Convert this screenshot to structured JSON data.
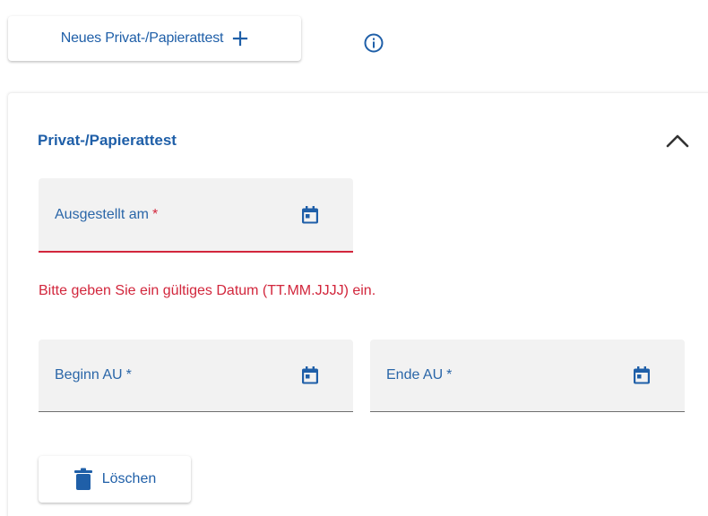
{
  "toolbar": {
    "new_attest_label": "Neues Privat-/Papierattest"
  },
  "card": {
    "title": "Privat-/Papierattest",
    "fields": {
      "issued": {
        "label": "Ausgestellt am",
        "required_mark": "*",
        "value": ""
      },
      "start": {
        "label": "Beginn AU",
        "required_mark": "*",
        "value": ""
      },
      "end": {
        "label": "Ende AU",
        "required_mark": "*",
        "value": ""
      }
    },
    "error_message": "Bitte geben Sie ein gültiges Datum (TT.MM.JJJJ) ein.",
    "delete_label": "Löschen"
  },
  "icons": {
    "add": "plus-icon",
    "info": "info-icon",
    "collapse": "chevron-up-icon",
    "calendar": "calendar-icon",
    "delete": "trash-icon"
  },
  "colors": {
    "primary": "#1f5fa8",
    "error": "#d2263c",
    "field_bg": "#f2f2f2"
  }
}
